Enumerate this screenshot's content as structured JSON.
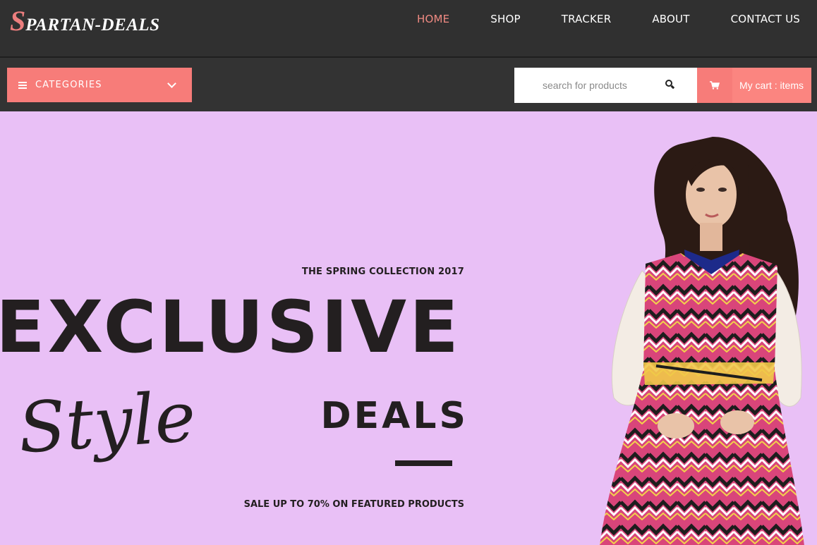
{
  "brand": {
    "initial": "S",
    "rest": "PARTAN-DEALS"
  },
  "nav": {
    "items": [
      {
        "label": "HOME",
        "active": true
      },
      {
        "label": "SHOP"
      },
      {
        "label": "TRACKER"
      },
      {
        "label": "ABOUT"
      },
      {
        "label": "CONTACT US"
      }
    ]
  },
  "toolbar": {
    "categories_label": "CATEGORIES",
    "search_placeholder": "search for products",
    "cart_label": "My cart : items"
  },
  "hero": {
    "kicker": "THE SPRING COLLECTION 2017",
    "headline": "EXCLUSIVE",
    "script_word": "Style",
    "subhead": "DEALS",
    "sale_text": "SALE UP TO 70% ON FEATURED PRODUCTS"
  },
  "colors": {
    "accent": "#f77c79",
    "nav_active": "#f08a82",
    "hero_bg": "#e9c0f6",
    "dark": "#303030"
  },
  "icons": [
    "bars-icon",
    "chevron-down-icon",
    "search-icon",
    "cart-icon"
  ]
}
